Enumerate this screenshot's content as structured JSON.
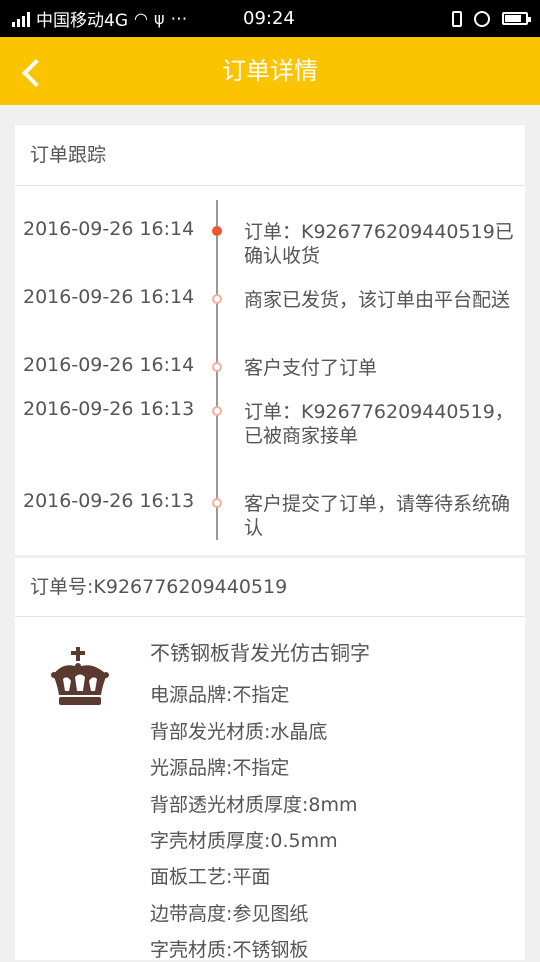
{
  "status_bar": {
    "carrier": "中国移动4G",
    "extra": "⋯",
    "time": "09:24",
    "battery_level": 0.9
  },
  "header": {
    "title": "订单详情"
  },
  "tracking": {
    "section_title": "订单跟踪",
    "events": [
      {
        "time": "2016-09-26 16:14",
        "text": "订单：K926776209440519已确认收货",
        "active": true
      },
      {
        "time": "2016-09-26 16:14",
        "text": "商家已发货，该订单由平台配送",
        "active": false
      },
      {
        "time": "2016-09-26 16:14",
        "text": "客户支付了订单",
        "active": false
      },
      {
        "time": "2016-09-26 16:13",
        "text": "订单：K926776209440519，已被商家接单",
        "active": false
      },
      {
        "time": "2016-09-26 16:13",
        "text": "客户提交了订单，请等待系统确认",
        "active": false
      }
    ]
  },
  "order": {
    "number_label": "订单号:K926776209440519"
  },
  "product": {
    "name": "不锈钢板背发光仿古铜字",
    "specs": [
      "电源品牌:不指定",
      "背部发光材质:水晶底",
      "光源品牌:不指定",
      "背部透光材质厚度:8mm",
      "字壳材质厚度:0.5mm",
      "面板工艺:平面",
      "边带高度:参见图纸",
      "字壳材质:不锈钢板"
    ]
  },
  "colors": {
    "header_bg": "#fcc300",
    "active_dot": "#ee5533"
  }
}
